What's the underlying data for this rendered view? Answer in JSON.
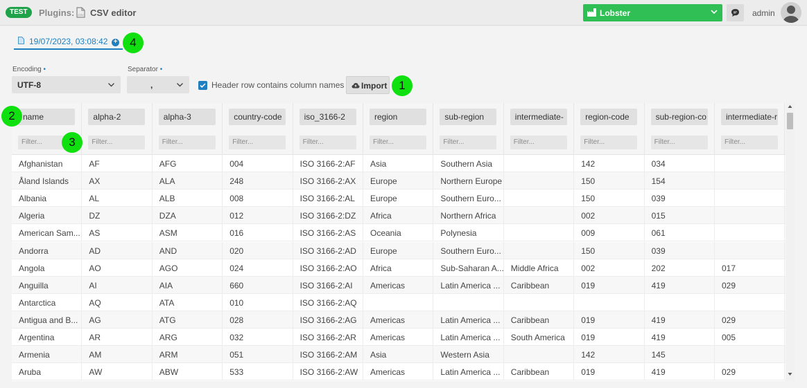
{
  "header": {
    "env_badge": "TEST",
    "breadcrumb_plugins": "Plugins:",
    "plugin_icon": "csv-file-icon",
    "title": "CSV editor",
    "company": "Lobster",
    "company_icon": "factory-icon",
    "user": "admin",
    "accent_color": "#2fbf54"
  },
  "tab": {
    "label": "19/07/2023, 03:08:42",
    "add_icon": "plus-circle-icon"
  },
  "markers": [
    "1",
    "2",
    "3",
    "4"
  ],
  "form": {
    "encoding_label": "Encoding",
    "encoding_value": "UTF-8",
    "separator_label": "Separator",
    "separator_value": ",",
    "required_mark": "•",
    "header_checkbox_label": "Header row contains column names",
    "header_checkbox_checked": true,
    "import_label": "Import"
  },
  "table": {
    "filter_placeholder": "Filter...",
    "columns": [
      "name",
      "alpha-2",
      "alpha-3",
      "country-code",
      "iso_3166-2",
      "region",
      "sub-region",
      "intermediate-",
      "region-code",
      "sub-region-co",
      "intermediate-r"
    ],
    "rows": [
      [
        "Afghanistan",
        "AF",
        "AFG",
        "004",
        "ISO 3166-2:AF",
        "Asia",
        "Southern Asia",
        "",
        "142",
        "034",
        ""
      ],
      [
        "Åland Islands",
        "AX",
        "ALA",
        "248",
        "ISO 3166-2:AX",
        "Europe",
        "Northern Europe",
        "",
        "150",
        "154",
        ""
      ],
      [
        "Albania",
        "AL",
        "ALB",
        "008",
        "ISO 3166-2:AL",
        "Europe",
        "Southern Euro...",
        "",
        "150",
        "039",
        ""
      ],
      [
        "Algeria",
        "DZ",
        "DZA",
        "012",
        "ISO 3166-2:DZ",
        "Africa",
        "Northern Africa",
        "",
        "002",
        "015",
        ""
      ],
      [
        "American Sam...",
        "AS",
        "ASM",
        "016",
        "ISO 3166-2:AS",
        "Oceania",
        "Polynesia",
        "",
        "009",
        "061",
        ""
      ],
      [
        "Andorra",
        "AD",
        "AND",
        "020",
        "ISO 3166-2:AD",
        "Europe",
        "Southern Euro...",
        "",
        "150",
        "039",
        ""
      ],
      [
        "Angola",
        "AO",
        "AGO",
        "024",
        "ISO 3166-2:AO",
        "Africa",
        "Sub-Saharan A...",
        "Middle Africa",
        "002",
        "202",
        "017"
      ],
      [
        "Anguilla",
        "AI",
        "AIA",
        "660",
        "ISO 3166-2:AI",
        "Americas",
        "Latin America ...",
        "Caribbean",
        "019",
        "419",
        "029"
      ],
      [
        "Antarctica",
        "AQ",
        "ATA",
        "010",
        "ISO 3166-2:AQ",
        "",
        "",
        "",
        "",
        "",
        ""
      ],
      [
        "Antigua and B...",
        "AG",
        "ATG",
        "028",
        "ISO 3166-2:AG",
        "Americas",
        "Latin America ...",
        "Caribbean",
        "019",
        "419",
        "029"
      ],
      [
        "Argentina",
        "AR",
        "ARG",
        "032",
        "ISO 3166-2:AR",
        "Americas",
        "Latin America ...",
        "South America",
        "019",
        "419",
        "005"
      ],
      [
        "Armenia",
        "AM",
        "ARM",
        "051",
        "ISO 3166-2:AM",
        "Asia",
        "Western Asia",
        "",
        "142",
        "145",
        ""
      ],
      [
        "Aruba",
        "AW",
        "ABW",
        "533",
        "ISO 3166-2:AW",
        "Americas",
        "Latin America ...",
        "Caribbean",
        "019",
        "419",
        "029"
      ]
    ]
  }
}
